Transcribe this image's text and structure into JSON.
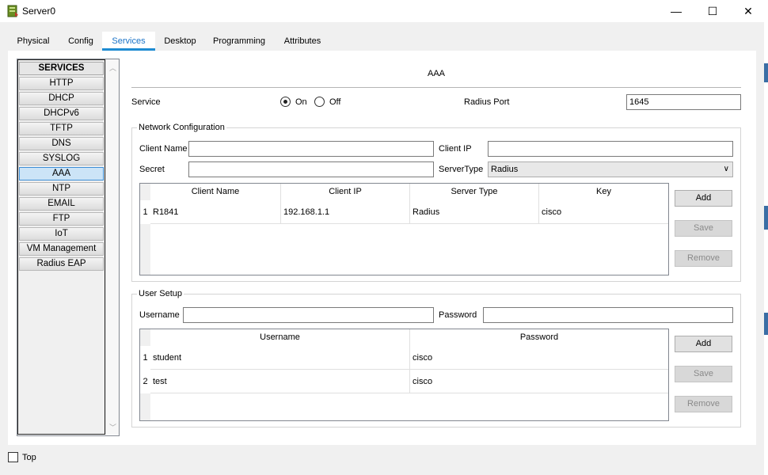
{
  "window": {
    "title": "Server0",
    "minimize_glyph": "—",
    "maximize_glyph": "☐",
    "close_glyph": "✕"
  },
  "tabs": [
    {
      "label": "Physical"
    },
    {
      "label": "Config"
    },
    {
      "label": "Services",
      "active": true
    },
    {
      "label": "Desktop"
    },
    {
      "label": "Programming"
    },
    {
      "label": "Attributes"
    }
  ],
  "services": {
    "header": "SERVICES",
    "items": [
      "HTTP",
      "DHCP",
      "DHCPv6",
      "TFTP",
      "DNS",
      "SYSLOG",
      "AAA",
      "NTP",
      "EMAIL",
      "FTP",
      "IoT",
      "VM Management",
      "Radius EAP"
    ],
    "selected": "AAA"
  },
  "aaa": {
    "title": "AAA",
    "service_label": "Service",
    "on_label": "On",
    "off_label": "Off",
    "service_state": "On",
    "radius_port_label": "Radius Port",
    "radius_port_value": "1645"
  },
  "network_config": {
    "legend": "Network Configuration",
    "client_name_label": "Client Name",
    "client_name_value": "",
    "client_ip_label": "Client IP",
    "client_ip_value": "",
    "secret_label": "Secret",
    "secret_value": "",
    "server_type_label": "ServerType",
    "server_type_value": "Radius",
    "columns": [
      "Client Name",
      "Client IP",
      "Server Type",
      "Key"
    ],
    "rows": [
      {
        "num": "1",
        "cells": [
          "R1841",
          "192.168.1.1",
          "Radius",
          "cisco"
        ]
      }
    ],
    "add_label": "Add",
    "save_label": "Save",
    "remove_label": "Remove"
  },
  "user_setup": {
    "legend": "User Setup",
    "username_label": "Username",
    "username_value": "",
    "password_label": "Password",
    "password_value": "",
    "columns": [
      "Username",
      "Password"
    ],
    "rows": [
      {
        "num": "1",
        "cells": [
          "student",
          "cisco"
        ]
      },
      {
        "num": "2",
        "cells": [
          "test",
          "cisco"
        ]
      }
    ],
    "add_label": "Add",
    "save_label": "Save",
    "remove_label": "Remove"
  },
  "footer": {
    "top_label": "Top"
  },
  "colors": {
    "accent": "#1e8bd2",
    "selected_bg": "#cce4f7"
  }
}
